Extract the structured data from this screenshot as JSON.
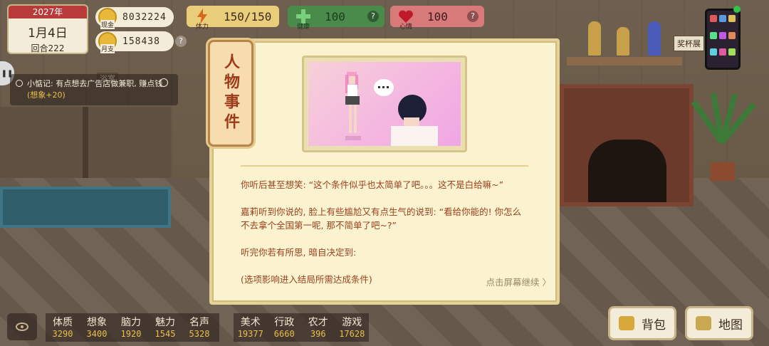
{
  "date": {
    "year": "2027年",
    "day": "1月4日",
    "turn": "回合222"
  },
  "money": [
    {
      "label": "现金",
      "value": "8032224"
    },
    {
      "label": "月支",
      "value": "158438"
    }
  ],
  "stats": [
    {
      "label": "体力",
      "value": "150/150",
      "icon": "lightning-icon"
    },
    {
      "label": "健康",
      "value": "100",
      "icon": "cross-icon"
    },
    {
      "label": "心情",
      "value": "100",
      "icon": "heart-icon"
    }
  ],
  "memo": {
    "prefix": "小惦记: 有点想去广告店做兼职, 赚点钱",
    "reward": "(想象+20)"
  },
  "scene": {
    "bathroom_label": "浴室",
    "trophy_label": "奖杯展"
  },
  "modal": {
    "tag": "人物事件",
    "paragraphs": [
      "你听后甚至想笑: “这个条件似乎也太简单了吧。。。这不是白给嘛~”",
      "嘉莉听到你说的, 脸上有些尴尬又有点生气的说到: “看给你能的! 你怎么不去拿个全国第一呢, 那不简单了吧~?”",
      "听完你若有所思, 暗自决定到:",
      "(选项影响进入结局所需达成条件)"
    ],
    "continue": "点击屏幕继续 〉"
  },
  "attributes_left": [
    {
      "name": "体质",
      "value": "3290"
    },
    {
      "name": "想象",
      "value": "3400"
    },
    {
      "name": "脑力",
      "value": "1920"
    },
    {
      "name": "魅力",
      "value": "1545"
    },
    {
      "name": "名声",
      "value": "5328"
    }
  ],
  "attributes_right": [
    {
      "name": "美术",
      "value": "19377"
    },
    {
      "name": "行政",
      "value": "6660"
    },
    {
      "name": "农才",
      "value": "396"
    },
    {
      "name": "游戏",
      "value": "17628"
    }
  ],
  "buttons": {
    "bag": "背包",
    "map": "地图"
  },
  "colors": {
    "accent_red": "#b83a3a",
    "story_text": "#9a3f1c",
    "panel": "#fbf3cf"
  }
}
